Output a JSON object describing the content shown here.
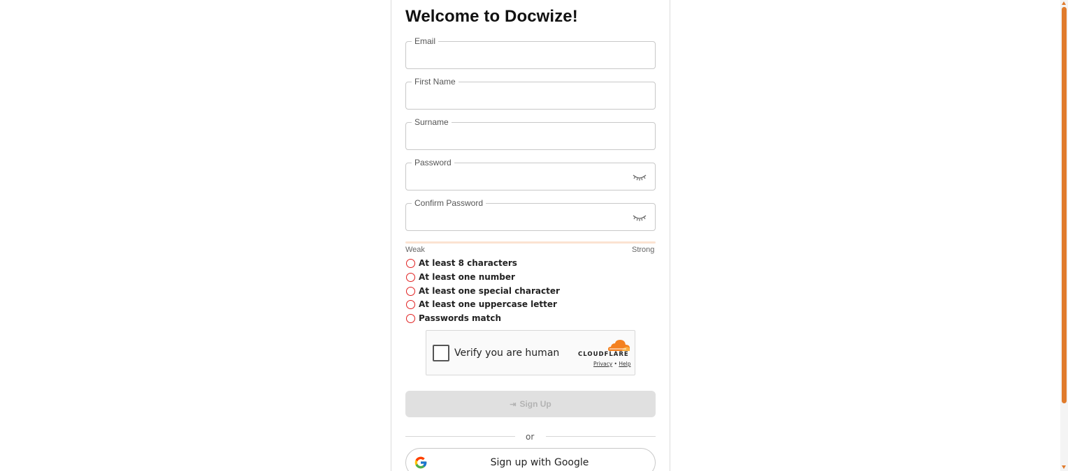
{
  "page": {
    "title": "Welcome to Docwize!"
  },
  "form": {
    "email_label": "Email",
    "email_value": "",
    "first_name_label": "First Name",
    "first_name_value": "",
    "surname_label": "Surname",
    "surname_value": "",
    "password_label": "Password",
    "password_value": "",
    "confirm_password_label": "Confirm Password",
    "confirm_password_value": ""
  },
  "strength": {
    "weak_label": "Weak",
    "strong_label": "Strong",
    "level": 0,
    "track_color": "#fbe3d2",
    "fill_color": "#e8742a"
  },
  "requirements": [
    {
      "text": "At least 8 characters",
      "met": false
    },
    {
      "text": "At least one number",
      "met": false
    },
    {
      "text": "At least one special character",
      "met": false
    },
    {
      "text": "At least one uppercase letter",
      "met": false
    },
    {
      "text": "Passwords match",
      "met": false
    }
  ],
  "captcha": {
    "label": "Verify you are human",
    "brand": "CLOUDFLARE",
    "privacy_link": "Privacy",
    "help_link": "Help",
    "separator": "•",
    "checked": false
  },
  "actions": {
    "signup_label": "Sign Up",
    "signup_icon": "login-icon",
    "signup_disabled": true,
    "divider_text": "or",
    "google_label": "Sign up with Google",
    "google_icon": "google-icon"
  },
  "colors": {
    "accent": "#e07b2c",
    "error": "#e02020",
    "disabled_bg": "#e0e0e0",
    "disabled_text": "#b3b3b3"
  }
}
